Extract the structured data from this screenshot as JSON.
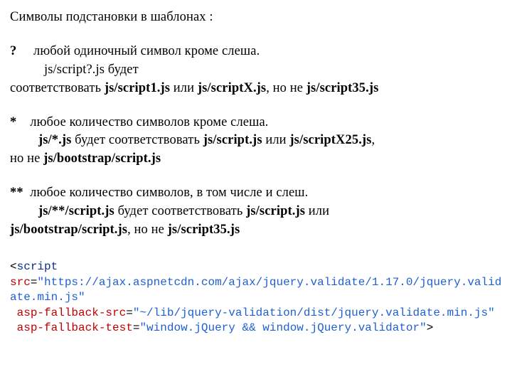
{
  "prose": {
    "heading": "Символы подстановки в шаблонах :",
    "q_sym": "?",
    "q_desc": "любой одиночный символ кроме слеша.",
    "q_ex_prefix": "js/script?.js будет",
    "q_match_lead": "соответствовать  ",
    "q_m1": "js/script1.js",
    "q_or": " или ",
    "q_m2": "js/scriptX.js",
    "q_but": ", но не ",
    "q_m3": "js/script35.js",
    "star_sym": "*",
    "star_desc": "любое количество символов кроме слеша.",
    "star_ex_pat": "js/*.js",
    "star_ex_mid": " будет соответствовать  ",
    "star_m1": "js/script.js",
    "star_or": " или ",
    "star_m2": "js/scriptX25.js",
    "star_tail_lead": "но не   ",
    "star_m3": "js/bootstrap/script.js",
    "dstar_sym": "**",
    "dstar_desc": "любое количество символов, в том числе и слеш.",
    "dstar_ex_pat": "js/**/script.js",
    "dstar_ex_mid": " будет соответствовать  ",
    "dstar_m1": "js/script.js",
    "dstar_or": " или",
    "dstar_m2": "js/bootstrap/script.js",
    "dstar_but": ", но не  ",
    "dstar_m3": "js/script35.js",
    "comma_tail": ","
  },
  "code": {
    "lt": "<",
    "gt": ">",
    "script": "script",
    "src_attr": "src",
    "src_val": "\"https://ajax.aspnetcdn.com/ajax/jquery.validate/1.17.0/jquery.validate.min.js\"",
    "fb_src_attr": "asp-fallback-src",
    "fb_src_val": "\"~/lib/jquery-validation/dist/jquery.validate.min.js\"",
    "fb_test_attr": "asp-fallback-test",
    "fb_test_val": "\"window.jQuery && window.jQuery.validator\"",
    "eq": "="
  }
}
